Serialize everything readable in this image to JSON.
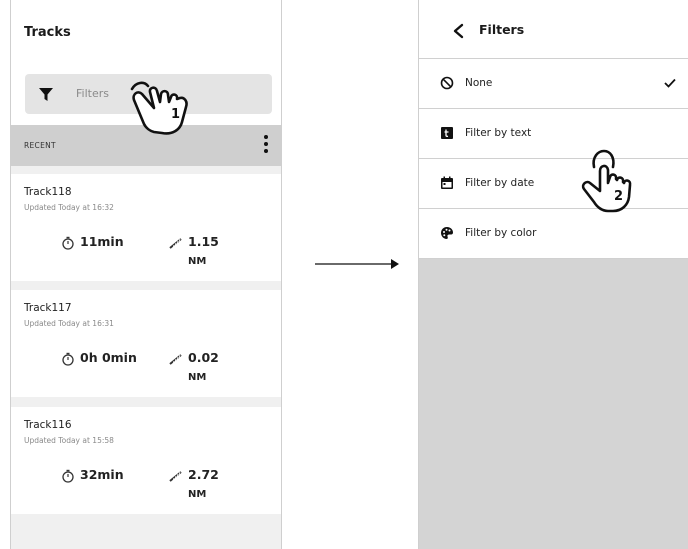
{
  "tracks_screen": {
    "title": "Tracks",
    "filter_placeholder": "Filters",
    "section_label": "RECENT",
    "tracks": [
      {
        "name": "Track118",
        "updated": "Updated Today at 16:32",
        "duration": "11min",
        "distance": "1.15",
        "unit": "NM"
      },
      {
        "name": "Track117",
        "updated": "Updated Today at 16:31",
        "duration": "0h 0min",
        "distance": "0.02",
        "unit": "NM"
      },
      {
        "name": "Track116",
        "updated": "Updated Today at 15:58",
        "duration": "32min",
        "distance": "2.72",
        "unit": "NM"
      }
    ],
    "step_label": "1"
  },
  "filters_screen": {
    "title": "Filters",
    "items": [
      {
        "label": "None",
        "icon": "block-icon",
        "selected": true
      },
      {
        "label": "Filter by text",
        "icon": "text-icon",
        "selected": false
      },
      {
        "label": "Filter by date",
        "icon": "calendar-icon",
        "selected": false
      },
      {
        "label": "Filter by color",
        "icon": "palette-icon",
        "selected": false
      }
    ],
    "step_label": "2"
  },
  "colors": {
    "recent_bar": "#cfcfcf",
    "filter_bar": "#e4e4e4",
    "empty_area": "#d4d4d4"
  }
}
